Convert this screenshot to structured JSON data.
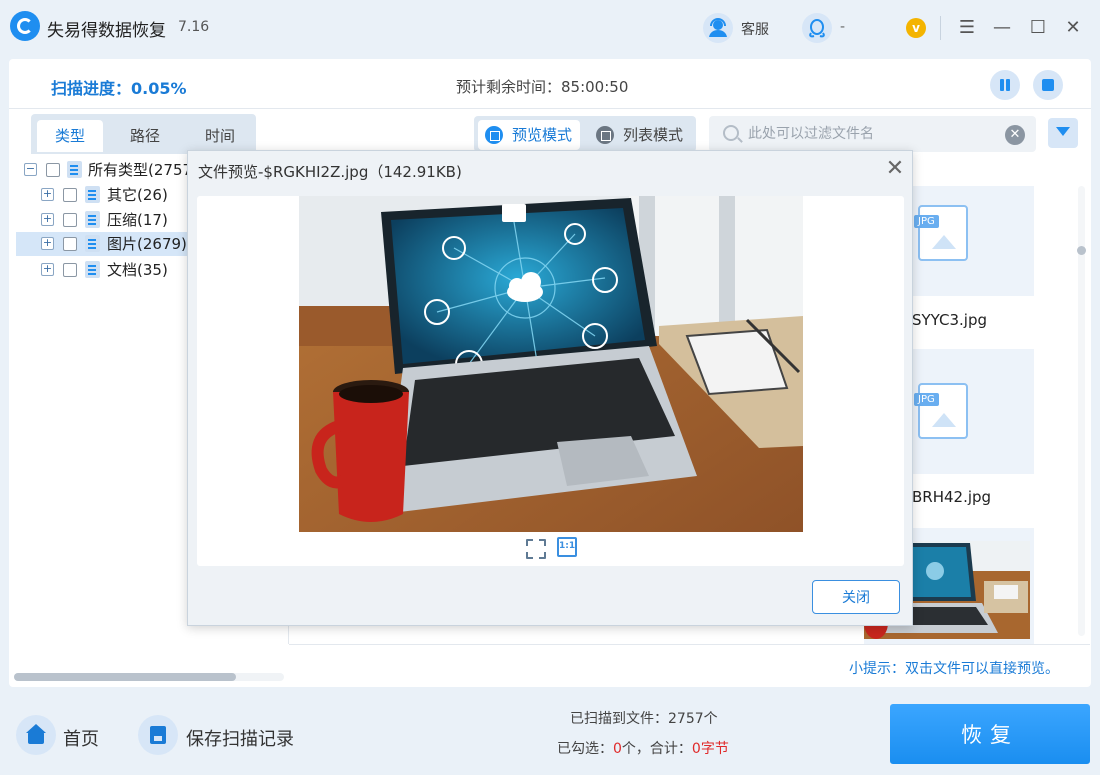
{
  "app": {
    "title": "失易得数据恢复",
    "version": "7.16",
    "kefu_label": "客服",
    "qq_label": "-",
    "vip_glyph": "v"
  },
  "window_controls": {
    "menu": "☰",
    "minimize": "—",
    "maximize": "☐",
    "close": "✕"
  },
  "scan": {
    "progress_label": "扫描进度：0.05%",
    "remaining_label": "预计剩余时间：85:00:50"
  },
  "tabs": [
    {
      "label": "类型",
      "active": true
    },
    {
      "label": "路径",
      "active": false
    },
    {
      "label": "时间",
      "active": false
    }
  ],
  "view_modes": [
    {
      "label": "预览模式",
      "active": true
    },
    {
      "label": "列表模式",
      "active": false
    }
  ],
  "search": {
    "placeholder": "此处可以过滤文件名",
    "value": ""
  },
  "tree": [
    {
      "label": "所有类型(2757)",
      "expander": "−",
      "level": 0
    },
    {
      "label": "其它(26)",
      "expander": "+",
      "level": 1
    },
    {
      "label": "压缩(17)",
      "expander": "+",
      "level": 1
    },
    {
      "label": "图片(2679)",
      "expander": "+",
      "level": 1,
      "selected": true
    },
    {
      "label": "文档(35)",
      "expander": "+",
      "level": 1
    }
  ],
  "files": [
    {
      "name": "SYYC3.jpg",
      "type_tag": "JPG"
    },
    {
      "name": "BRH42.jpg",
      "type_tag": "JPG"
    }
  ],
  "tip": "小提示：双击文件可以直接预览。",
  "modal": {
    "title": "文件预览-$RGKHI2Z.jpg（142.91KB)",
    "close_glyph": "✕",
    "close_button": "关闭",
    "actual_size_glyph": "1:1"
  },
  "bottom": {
    "home_label": "首页",
    "save_label": "保存扫描记录",
    "scanned_label": "已扫描到文件：2757个",
    "selected_prefix": "已勾选：",
    "selected_count": "0",
    "selected_mid": "个，合计：",
    "selected_size": "0字节",
    "recover_label": "恢复"
  },
  "colors": {
    "accent": "#1a7bd6",
    "primary_button": "#1a8ef0",
    "highlight_red": "#e02a2a"
  }
}
